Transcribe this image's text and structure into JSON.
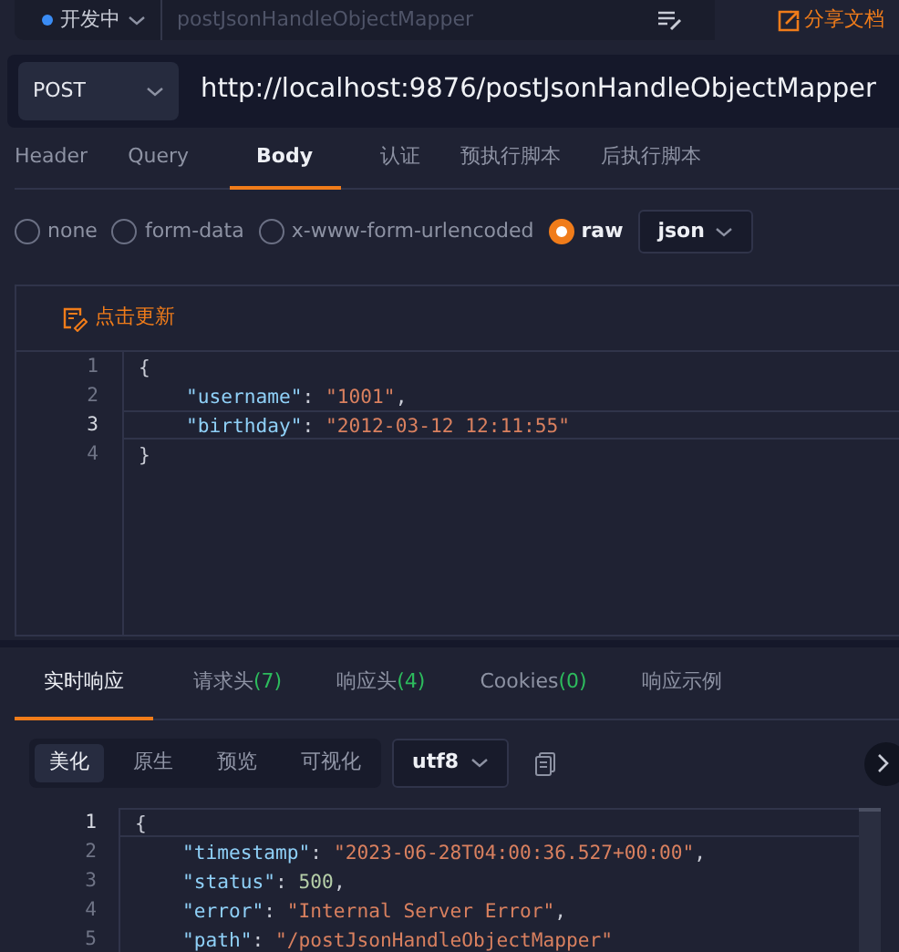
{
  "top_bar": {
    "environment": "开发中",
    "name_field": {
      "placeholder": "postJsonHandleObjectMapper"
    },
    "share_link": "分享文档"
  },
  "request": {
    "method": "POST",
    "url": "http://localhost:9876/postJsonHandleObjectMapper"
  },
  "tabs": [
    {
      "label": "Header",
      "selected": false
    },
    {
      "label": "Query",
      "selected": false
    },
    {
      "label": "Body",
      "selected": true
    },
    {
      "label": "认证",
      "selected": false
    },
    {
      "label": "预执行脚本",
      "selected": false
    },
    {
      "label": "后执行脚本",
      "selected": false
    }
  ],
  "body_types": [
    {
      "label": "none",
      "selected": false
    },
    {
      "label": "form-data",
      "selected": false
    },
    {
      "label": "x-www-form-urlencoded",
      "selected": false
    },
    {
      "label": "raw",
      "selected": true
    }
  ],
  "body_format": "json",
  "editor": {
    "update_button": "点击更新",
    "lines": [
      {
        "number": "1",
        "highlighted": false,
        "indented": false,
        "tokens": [
          {
            "kind": "punct",
            "text": "{"
          }
        ]
      },
      {
        "number": "2",
        "highlighted": false,
        "indented": true,
        "tokens": [
          {
            "kind": "key",
            "text": "\"username\""
          },
          {
            "kind": "punct",
            "text": ": "
          },
          {
            "kind": "string",
            "text": "\"1001\""
          },
          {
            "kind": "punct",
            "text": ","
          }
        ]
      },
      {
        "number": "3",
        "highlighted": true,
        "indented": true,
        "tokens": [
          {
            "kind": "key",
            "text": "\"birthday\""
          },
          {
            "kind": "punct",
            "text": ": "
          },
          {
            "kind": "string",
            "text": "\"2012-03-12 12:11:55\""
          }
        ]
      },
      {
        "number": "4",
        "highlighted": false,
        "indented": false,
        "tokens": [
          {
            "kind": "punct",
            "text": "}"
          }
        ]
      }
    ]
  },
  "response_tabs": [
    {
      "label": "实时响应",
      "selected": true
    },
    {
      "label": "请求头",
      "count": "(7)",
      "selected": false
    },
    {
      "label": "响应头",
      "count": "(4)",
      "selected": false
    },
    {
      "label": "Cookies",
      "count": "(0)",
      "selected": false
    },
    {
      "label": "响应示例",
      "selected": false
    }
  ],
  "view_modes": [
    {
      "label": "美化",
      "selected": true
    },
    {
      "label": "原生",
      "selected": false
    },
    {
      "label": "预览",
      "selected": false
    },
    {
      "label": "可视化",
      "selected": false
    }
  ],
  "encoding": "utf8",
  "response": {
    "lines": [
      {
        "number": "1",
        "highlighted": true,
        "indented": false,
        "tokens": [
          {
            "kind": "punct",
            "text": "{"
          }
        ]
      },
      {
        "number": "2",
        "highlighted": false,
        "indented": true,
        "tokens": [
          {
            "kind": "key",
            "text": "\"timestamp\""
          },
          {
            "kind": "punct",
            "text": ": "
          },
          {
            "kind": "string",
            "text": "\"2023-06-28T04:00:36.527+00:00\""
          },
          {
            "kind": "punct",
            "text": ","
          }
        ]
      },
      {
        "number": "3",
        "highlighted": false,
        "indented": true,
        "tokens": [
          {
            "kind": "key",
            "text": "\"status\""
          },
          {
            "kind": "punct",
            "text": ": "
          },
          {
            "kind": "number",
            "text": "500"
          },
          {
            "kind": "punct",
            "text": ","
          }
        ]
      },
      {
        "number": "4",
        "highlighted": false,
        "indented": true,
        "tokens": [
          {
            "kind": "key",
            "text": "\"error\""
          },
          {
            "kind": "punct",
            "text": ": "
          },
          {
            "kind": "string",
            "text": "\"Internal Server Error\""
          },
          {
            "kind": "punct",
            "text": ","
          }
        ]
      },
      {
        "number": "5",
        "highlighted": false,
        "indented": true,
        "tokens": [
          {
            "kind": "key",
            "text": "\"path\""
          },
          {
            "kind": "punct",
            "text": ": "
          },
          {
            "kind": "string",
            "text": "\"/postJsonHandleObjectMapper\""
          }
        ]
      }
    ]
  }
}
